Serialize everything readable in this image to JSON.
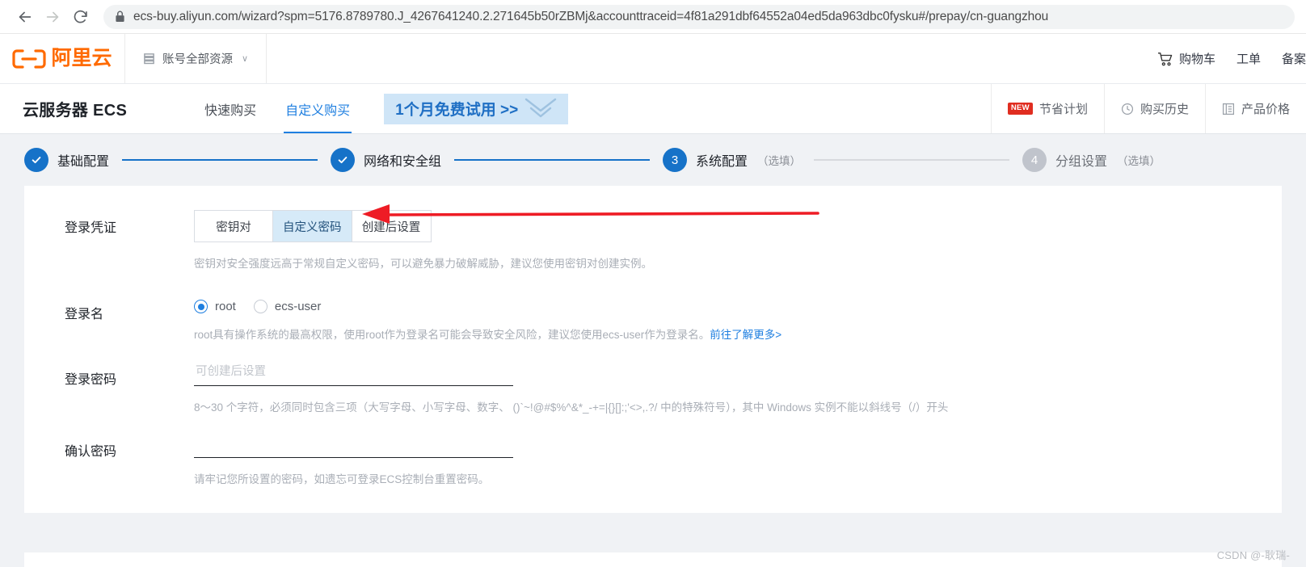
{
  "browser": {
    "back_icon": "back-arrow-icon",
    "forward_icon": "forward-arrow-icon",
    "reload_icon": "reload-icon",
    "lock_icon": "lock-icon",
    "url": "ecs-buy.aliyun.com/wizard?spm=5176.8789780.J_4267641240.2.271645b50rZBMj&accounttraceid=4f81a291dbf64552a04ed5da963dbc0fysku#/prepay/cn-guangzhou"
  },
  "header": {
    "logo_text": "阿里云",
    "account_resources": "账号全部资源",
    "caret": "∨",
    "right_items": [
      {
        "label": "购物车",
        "icon": "cart-icon"
      },
      {
        "label": "工单",
        "icon": ""
      },
      {
        "label": "备案",
        "icon": ""
      }
    ]
  },
  "product_nav": {
    "title": "云服务器 ECS",
    "tabs": [
      {
        "label": "快速购买",
        "active": false
      },
      {
        "label": "自定义购买",
        "active": true
      }
    ],
    "trial_badge": "1个月免费试用 >>",
    "right_items": [
      {
        "label": "节省计划",
        "badge": "NEW",
        "icon": ""
      },
      {
        "label": "购买历史",
        "badge": "",
        "icon": "clock-icon"
      },
      {
        "label": "产品价格",
        "badge": "",
        "icon": "list-icon"
      }
    ]
  },
  "steps": [
    {
      "num": "1",
      "check": "✓",
      "label": "基础配置",
      "optional": "",
      "state": "done"
    },
    {
      "num": "2",
      "check": "✓",
      "label": "网络和安全组",
      "optional": "",
      "state": "done"
    },
    {
      "num": "3",
      "check": "",
      "label": "系统配置",
      "optional": "（选填）",
      "state": "active"
    },
    {
      "num": "4",
      "check": "",
      "label": "分组设置",
      "optional": "（选填）",
      "state": "todo"
    }
  ],
  "form": {
    "credential": {
      "label": "登录凭证",
      "options": [
        {
          "label": "密钥对",
          "selected": false
        },
        {
          "label": "自定义密码",
          "selected": true
        },
        {
          "label": "创建后设置",
          "selected": false
        }
      ],
      "hint": "密钥对安全强度远高于常规自定义密码，可以避免暴力破解威胁，建议您使用密钥对创建实例。"
    },
    "login_name": {
      "label": "登录名",
      "options": [
        {
          "label": "root",
          "selected": true
        },
        {
          "label": "ecs-user",
          "selected": false
        }
      ],
      "hint": "root具有操作系统的最高权限，使用root作为登录名可能会导致安全风险，建议您使用ecs-user作为登录名。",
      "hint_link": "前往了解更多>"
    },
    "password": {
      "label": "登录密码",
      "placeholder": "可创建后设置",
      "value": "",
      "hint": "8～30 个字符，必须同时包含三项（大写字母、小写字母、数字、 ()`~!@#$%^&*_-+=|{}[]:;'<>,.?/ 中的特殊符号），其中 Windows 实例不能以斜线号（/）开头"
    },
    "confirm_password": {
      "label": "确认密码",
      "placeholder": "",
      "value": "",
      "hint": "请牢记您所设置的密码，如遗忘可登录ECS控制台重置密码。"
    }
  },
  "annotation": {
    "arrow_color": "#ee1c25"
  },
  "watermark": "CSDN @-耿瑞-"
}
